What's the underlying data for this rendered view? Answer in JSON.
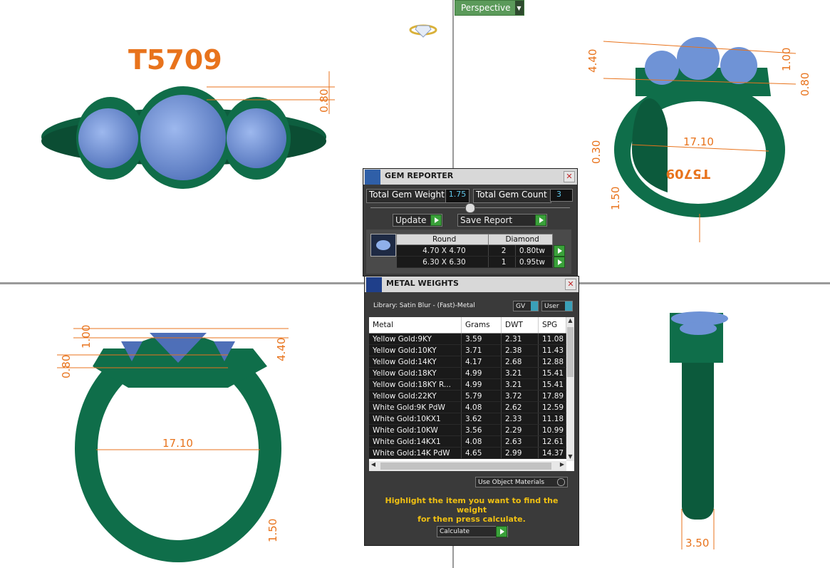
{
  "viewport": {
    "perspective_label": "Perspective",
    "top_left_code": "T5709",
    "mirror_code": "T5709",
    "dims_top_left": [
      "0.80"
    ],
    "dims_top_right": [
      "4.40",
      "1.00",
      "0.80",
      "17.10",
      "0.30",
      "1.50"
    ],
    "dims_bottom_left": [
      "1.00",
      "0.80",
      "4.40",
      "17.10",
      "1.50"
    ],
    "dims_bottom_right": [
      "3.50"
    ]
  },
  "gem_reporter": {
    "title": "GEM REPORTER",
    "total_weight_label": "Total Gem Weight",
    "total_weight_value": "1.75",
    "total_count_label": "Total Gem Count",
    "total_count_value": "3",
    "update_label": "Update",
    "save_report_label": "Save Report",
    "table_headers": [
      "Round",
      "Diamond"
    ],
    "rows": [
      {
        "size": "4.70 X 4.70",
        "count": "2",
        "weight": "0.80tw"
      },
      {
        "size": "6.30 X 6.30",
        "count": "1",
        "weight": "0.95tw"
      }
    ]
  },
  "metal_weights": {
    "title": "METAL WEIGHTS",
    "library": "Library: Satin Blur - (Fast)-Metal",
    "gv_label": "GV",
    "user_label": "User",
    "columns": [
      "Metal",
      "Grams",
      "DWT",
      "SPG"
    ],
    "rows": [
      [
        "Yellow Gold:9KY",
        "3.59",
        "2.31",
        "11.08"
      ],
      [
        "Yellow Gold:10KY",
        "3.71",
        "2.38",
        "11.43"
      ],
      [
        "Yellow Gold:14KY",
        "4.17",
        "2.68",
        "12.88"
      ],
      [
        "Yellow Gold:18KY",
        "4.99",
        "3.21",
        "15.41"
      ],
      [
        "Yellow Gold:18KY R...",
        "4.99",
        "3.21",
        "15.41"
      ],
      [
        "Yellow Gold:22KY",
        "5.79",
        "3.72",
        "17.89"
      ],
      [
        "White Gold:9K PdW",
        "4.08",
        "2.62",
        "12.59"
      ],
      [
        "White Gold:10KX1",
        "3.62",
        "2.33",
        "11.18"
      ],
      [
        "White Gold:10KW",
        "3.56",
        "2.29",
        "10.99"
      ],
      [
        "White Gold:14KX1",
        "4.08",
        "2.63",
        "12.61"
      ],
      [
        "White Gold:14K PdW",
        "4.65",
        "2.99",
        "14.37"
      ]
    ],
    "use_object_materials_label": "Use Object Materials",
    "hint_line1": "Highlight the item you want to find the weight",
    "hint_line2": "for then press calculate.",
    "calculate_label": "Calculate"
  },
  "colors": {
    "metal_green": "#0f6e4a",
    "gem_blue": "#6f93d6",
    "dimension_orange": "#e8731c"
  }
}
